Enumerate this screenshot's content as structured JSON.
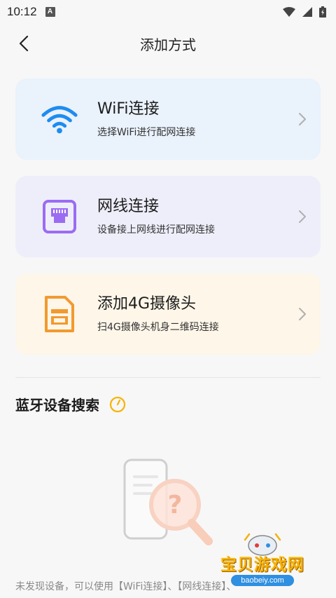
{
  "status_bar": {
    "time": "10:12",
    "notification_glyph": "A"
  },
  "header": {
    "title": "添加方式"
  },
  "options": [
    {
      "title": "WiFi连接",
      "subtitle": "选择WiFi进行配网连接",
      "icon": "wifi-icon",
      "accent": "#1e8cf0"
    },
    {
      "title": "网线连接",
      "subtitle": "设备接上网线进行配网连接",
      "icon": "ethernet-port-icon",
      "accent": "#9b6cf2"
    },
    {
      "title": "添加4G摄像头",
      "subtitle": "扫4G摄像头机身二维码连接",
      "icon": "sim-card-icon",
      "accent": "#f29a2e"
    }
  ],
  "bluetooth": {
    "title": "蓝牙设备搜索",
    "empty_text": "未发现设备，可以使用【WiFi连接】、【网线连接】、"
  },
  "watermark": {
    "text": "宝贝游戏网",
    "url": "baobeiy.com"
  }
}
